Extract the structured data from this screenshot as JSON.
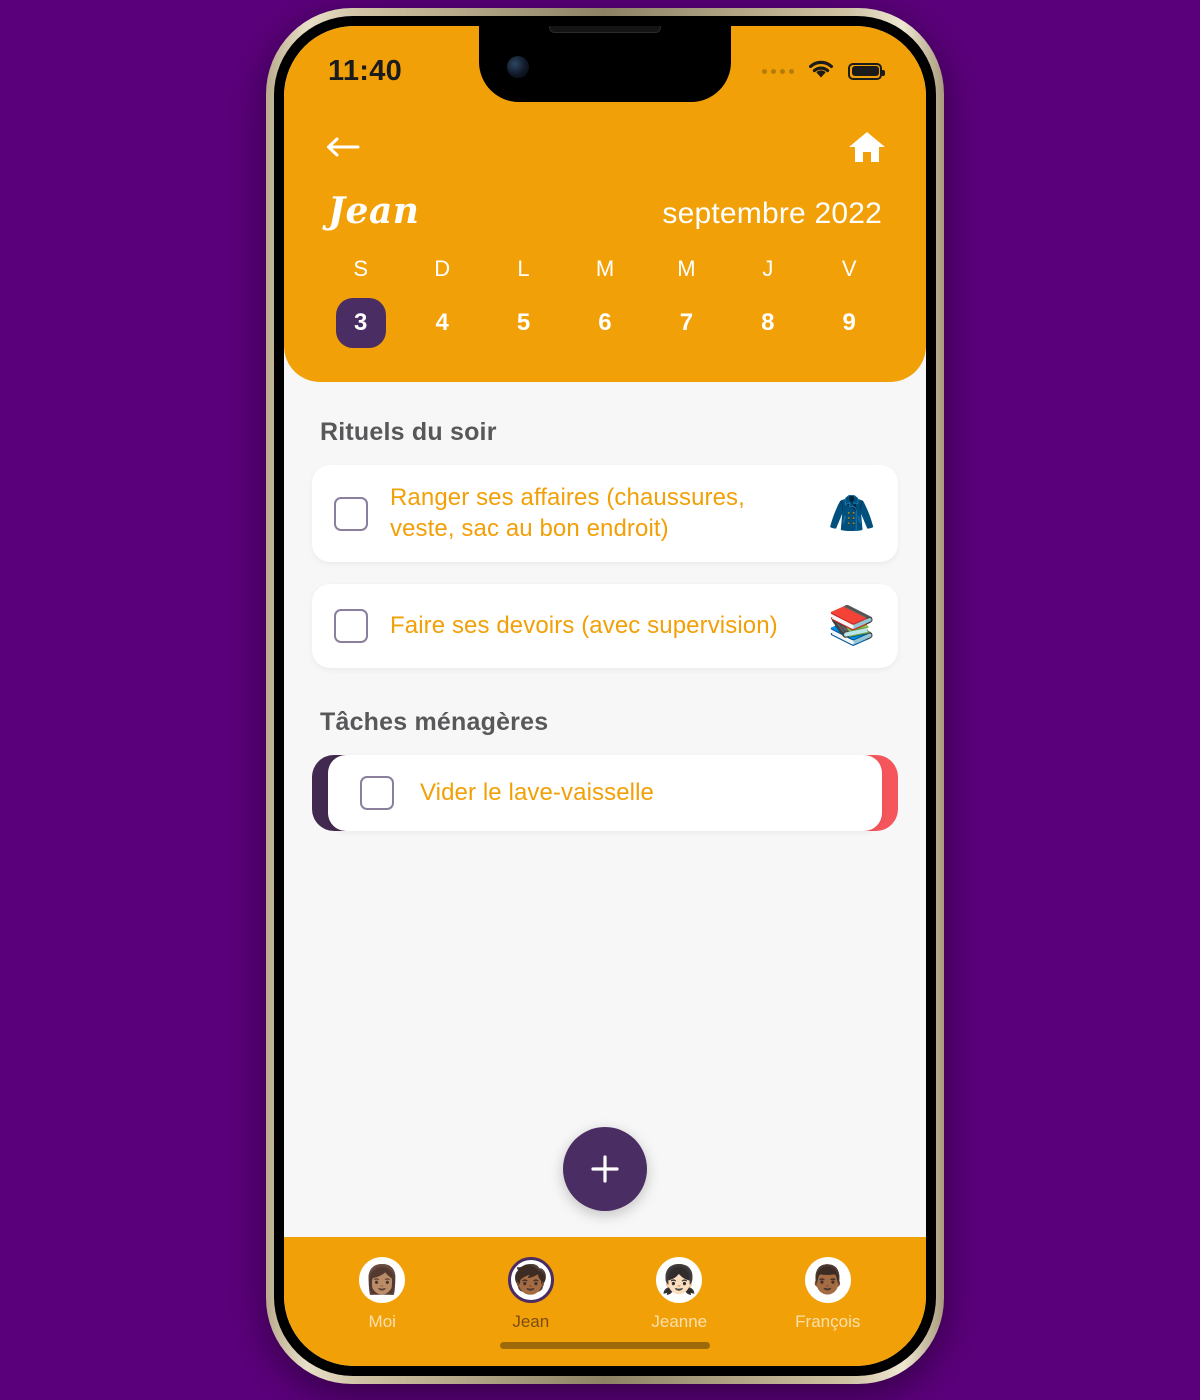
{
  "theme": {
    "page_background": "#5B007B",
    "accent_orange": "#F2A007",
    "accent_purple": "#4A2D63",
    "swipe_left_color": "#41294F",
    "swipe_right_color": "#F4565B",
    "content_background": "#F7F7F7",
    "task_text_color": "#F2A007",
    "section_title_color": "#58585A"
  },
  "status_bar": {
    "time": "11:40",
    "signal_icon": "signal-dots-icon",
    "wifi_icon": "wifi-icon",
    "battery_icon": "battery-full-icon"
  },
  "header": {
    "back_icon": "arrow-left-icon",
    "home_icon": "home-icon",
    "child_name": "Jean",
    "month": "septembre 2022",
    "week": [
      {
        "dow": "S",
        "day": "3",
        "selected": true
      },
      {
        "dow": "D",
        "day": "4",
        "selected": false
      },
      {
        "dow": "L",
        "day": "5",
        "selected": false
      },
      {
        "dow": "M",
        "day": "6",
        "selected": false
      },
      {
        "dow": "M",
        "day": "7",
        "selected": false
      },
      {
        "dow": "J",
        "day": "8",
        "selected": false
      },
      {
        "dow": "V",
        "day": "9",
        "selected": false
      }
    ]
  },
  "sections": [
    {
      "title": "Rituels du soir",
      "tasks": [
        {
          "label": "Ranger ses affaires (chaussures, veste, sac au bon endroit)",
          "emoji": "🧥",
          "emoji_name": "coat-wardrobe-icon",
          "checked": false,
          "swiped": false
        },
        {
          "label": "Faire ses devoirs (avec supervision)",
          "emoji": "📚",
          "emoji_name": "books-icon",
          "checked": false,
          "swiped": false
        }
      ]
    },
    {
      "title": "Tâches ménagères",
      "tasks": [
        {
          "label": "Vider le lave-vaisselle",
          "emoji": "",
          "emoji_name": "",
          "checked": false,
          "swiped": true
        }
      ]
    }
  ],
  "fab": {
    "icon": "plus-icon",
    "label": "+"
  },
  "tabbar": {
    "tabs": [
      {
        "label": "Moi",
        "avatar": "👩🏽",
        "active": false
      },
      {
        "label": "Jean",
        "avatar": "🧒🏾",
        "active": true
      },
      {
        "label": "Jeanne",
        "avatar": "👧🏻",
        "active": false
      },
      {
        "label": "François",
        "avatar": "👨🏾",
        "active": false
      }
    ]
  }
}
